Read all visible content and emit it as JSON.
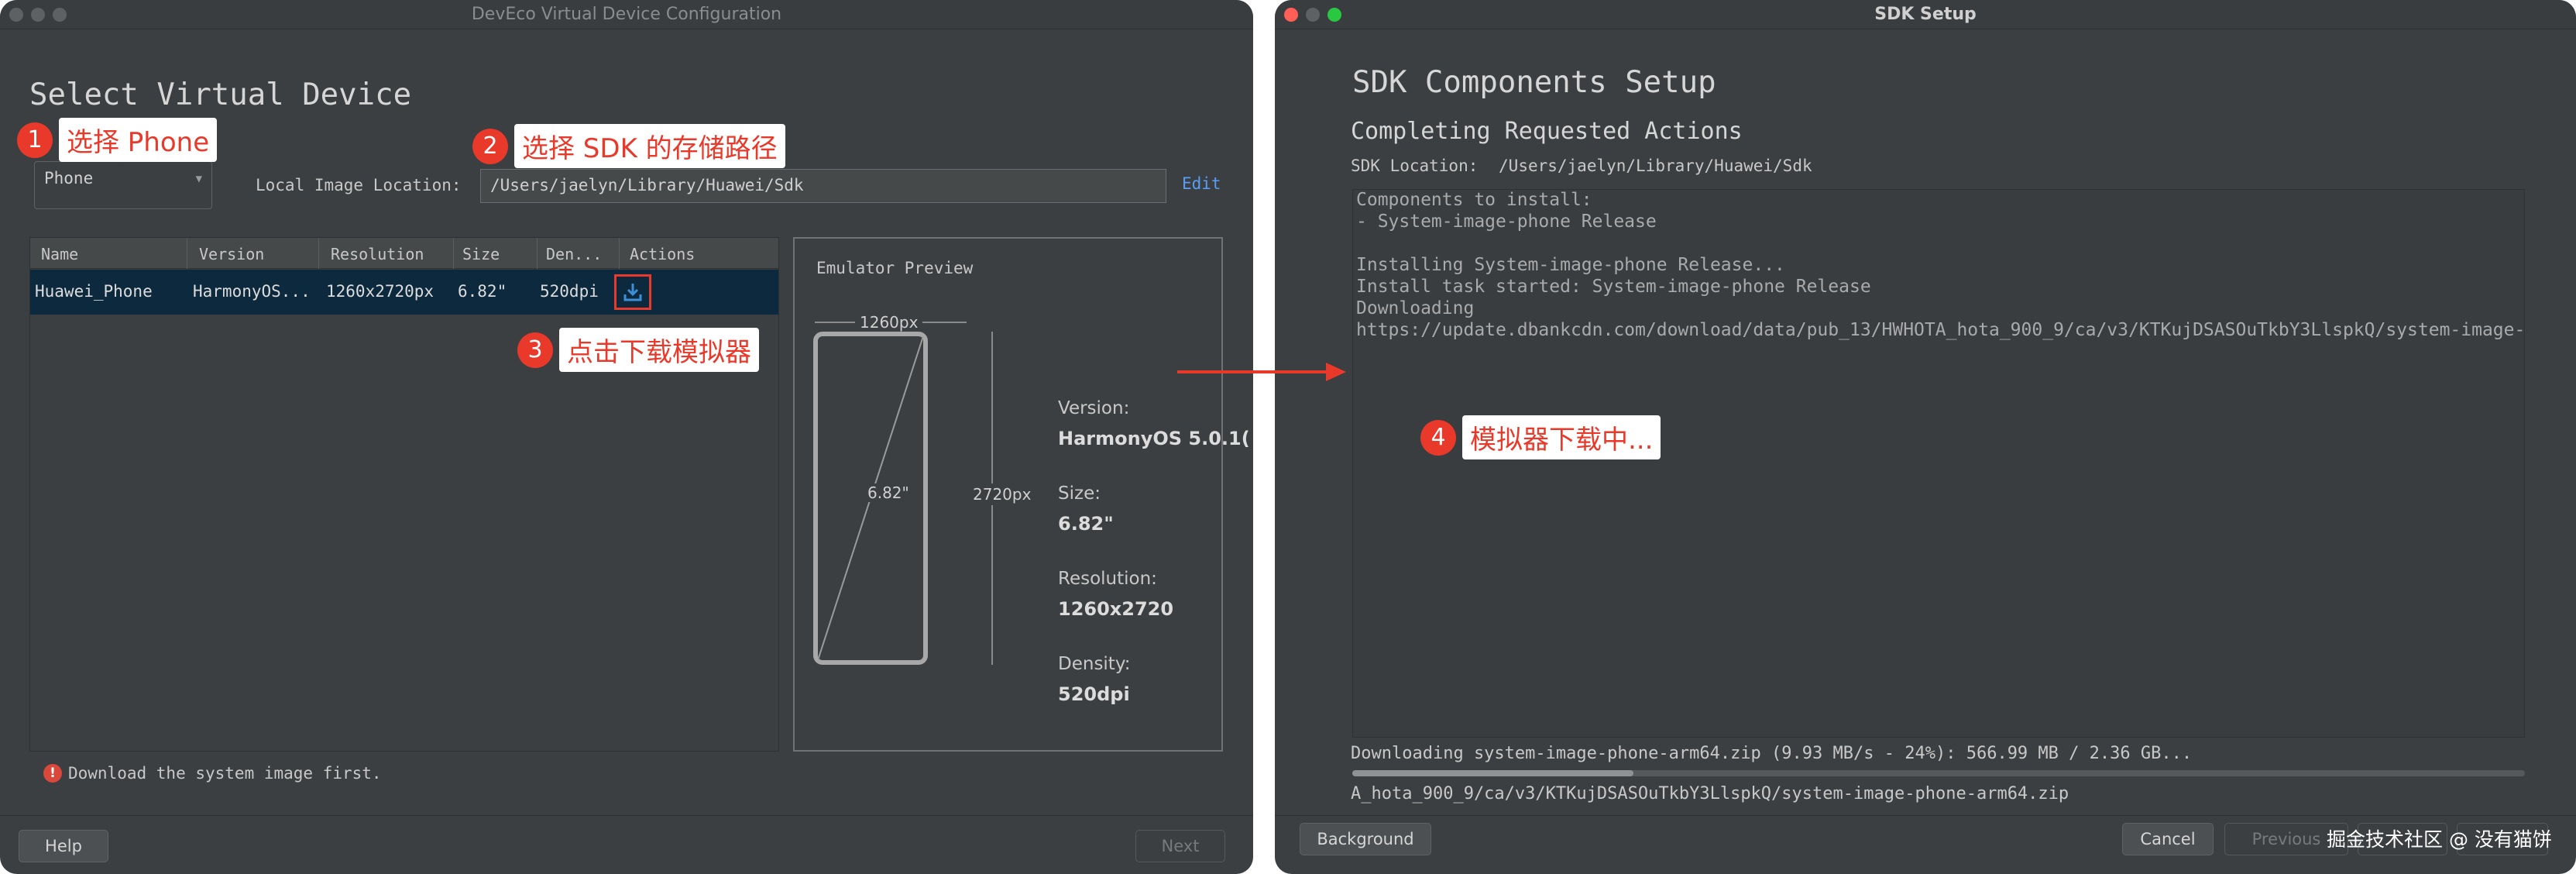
{
  "left_window": {
    "title": "DevEco Virtual Device Configuration",
    "heading": "Select Virtual Device",
    "device_type": "Phone",
    "location_label": "Local Image Location:",
    "location_value": "/Users/jaelyn/Library/Huawei/Sdk",
    "edit_label": "Edit",
    "table": {
      "columns": [
        "Name",
        "Version",
        "Resolution",
        "Size",
        "Den...",
        "Actions"
      ],
      "row": {
        "name": "Huawei_Phone",
        "version": "HarmonyOS...",
        "resolution": "1260x2720px",
        "size": "6.82\"",
        "density": "520dpi",
        "action_icon": "download-icon"
      }
    },
    "preview": {
      "title": "Emulator Preview",
      "width_label": "1260px",
      "height_label": "2720px",
      "diagonal_label": "6.82\"",
      "version_label": "Version:",
      "version_value": "HarmonyOS 5.0.1(",
      "size_label": "Size:",
      "size_value": "6.82\"",
      "resolution_label": "Resolution:",
      "resolution_value": "1260x2720",
      "density_label": "Density:",
      "density_value": "520dpi"
    },
    "error_text": "Download the system image first.",
    "help_button": "Help",
    "next_button": "Next"
  },
  "right_window": {
    "title": "SDK Setup",
    "heading": "SDK Components Setup",
    "subheading": "Completing Requested Actions",
    "location_label": "SDK Location:",
    "location_value": "/Users/jaelyn/Library/Huawei/Sdk",
    "console_lines": [
      "Components to install:",
      "- System-image-phone Release",
      "",
      "Installing System-image-phone Release...",
      "Install task started: System-image-phone Release",
      "Downloading",
      "https://update.dbankcdn.com/download/data/pub_13/HWHOTA_hota_900_9/ca/v3/KTKujDSASOuTkbY3LlspkQ/system-image-"
    ],
    "status_text": "Downloading system-image-phone-arm64.zip (9.93 MB/s - 24%): 566.99 MB / 2.36 GB...",
    "progress": 0.24,
    "path_text": "A_hota_900_9/ca/v3/KTKujDSASOuTkbY3LlspkQ/system-image-phone-arm64.zip",
    "background_button": "Background",
    "cancel_button": "Cancel",
    "previous_button": "Previous"
  },
  "annotations": [
    {
      "num": "1",
      "text": "选择 Phone"
    },
    {
      "num": "2",
      "text": "选择 SDK 的存储路径"
    },
    {
      "num": "3",
      "text": "点击下载模拟器"
    },
    {
      "num": "4",
      "text": "模拟器下载中..."
    }
  ],
  "watermark": "掘金技术社区 @ 没有猫饼",
  "colors": {
    "window_bg": "#3c3f41",
    "selection": "#0d293e",
    "accent_red": "#e8392a",
    "link_blue": "#589df6",
    "download_blue": "#3d8fd8"
  }
}
